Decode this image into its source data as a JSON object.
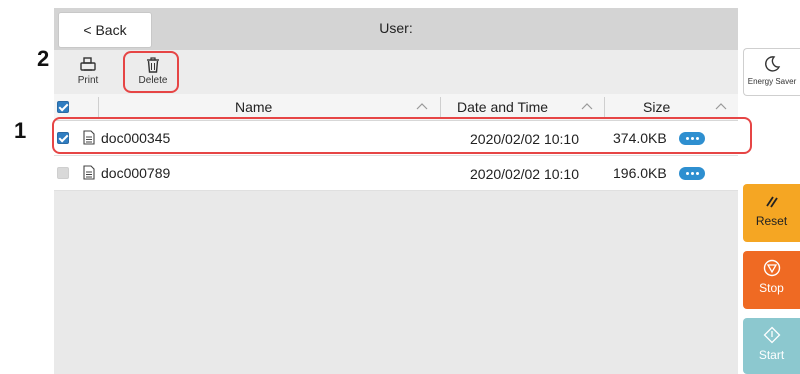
{
  "header": {
    "back_label": "< Back",
    "title": "User:"
  },
  "toolbar": {
    "print_label": "Print",
    "delete_label": "Delete"
  },
  "table": {
    "columns": [
      "Name",
      "Date and Time",
      "Size"
    ],
    "rows": [
      {
        "name": "doc000345",
        "date": "2020/02/02 10:10",
        "size": "374.0KB",
        "checked": true
      },
      {
        "name": "doc000789",
        "date": "2020/02/02 10:10",
        "size": "196.0KB",
        "checked": false
      }
    ]
  },
  "side_buttons": {
    "energy_saver": "Energy Saver",
    "reset": "Reset",
    "stop": "Stop",
    "start": "Start"
  },
  "callouts": {
    "one": "1",
    "two": "2"
  },
  "colors": {
    "highlight": "#e64545",
    "checkbox_blue": "#2f7dc1",
    "reset": "#f5a623",
    "stop": "#ef6a23",
    "start": "#8cc8cf"
  }
}
